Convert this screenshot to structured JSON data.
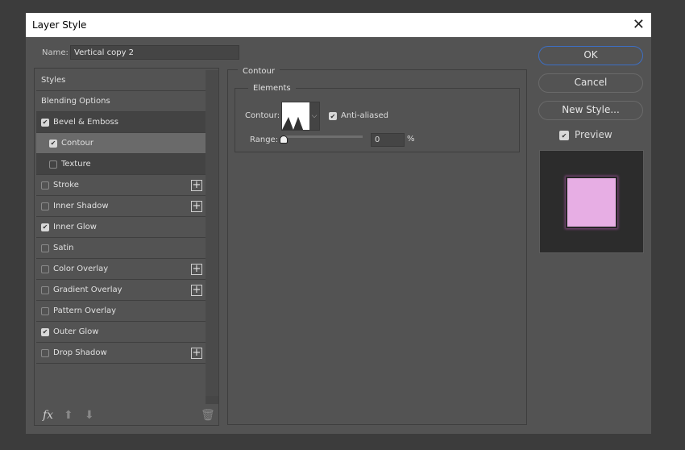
{
  "title": "Layer Style",
  "name_label": "Name:",
  "name_value": "Vertical copy 2",
  "styles": [
    {
      "label": "Styles",
      "checkbox": null,
      "plus": false
    },
    {
      "label": "Blending Options",
      "checkbox": null,
      "plus": false
    },
    {
      "label": "Bevel & Emboss",
      "checkbox": true,
      "plus": false
    },
    {
      "label": "Contour",
      "checkbox": true,
      "plus": false,
      "selected": true
    },
    {
      "label": "Texture",
      "checkbox": false,
      "plus": false
    },
    {
      "label": "Stroke",
      "checkbox": false,
      "plus": true
    },
    {
      "label": "Inner Shadow",
      "checkbox": false,
      "plus": true
    },
    {
      "label": "Inner Glow",
      "checkbox": true,
      "plus": false
    },
    {
      "label": "Satin",
      "checkbox": false,
      "plus": false
    },
    {
      "label": "Color Overlay",
      "checkbox": false,
      "plus": true
    },
    {
      "label": "Gradient Overlay",
      "checkbox": false,
      "plus": true
    },
    {
      "label": "Pattern Overlay",
      "checkbox": false,
      "plus": false
    },
    {
      "label": "Outer Glow",
      "checkbox": true,
      "plus": false
    },
    {
      "label": "Drop Shadow",
      "checkbox": false,
      "plus": true
    }
  ],
  "footer": {
    "fx": "fx"
  },
  "panel": {
    "title": "Contour",
    "group": "Elements",
    "contour_label": "Contour:",
    "anti_aliased": "Anti-aliased",
    "anti_aliased_checked": true,
    "range_label": "Range:",
    "range_value": "0",
    "range_unit": "%"
  },
  "buttons": {
    "ok": "OK",
    "cancel": "Cancel",
    "new_style": "New Style...",
    "preview": "Preview",
    "preview_checked": true
  },
  "colors": {
    "accent": "#3d6fc4",
    "preview_fill": "#e7aee4"
  }
}
